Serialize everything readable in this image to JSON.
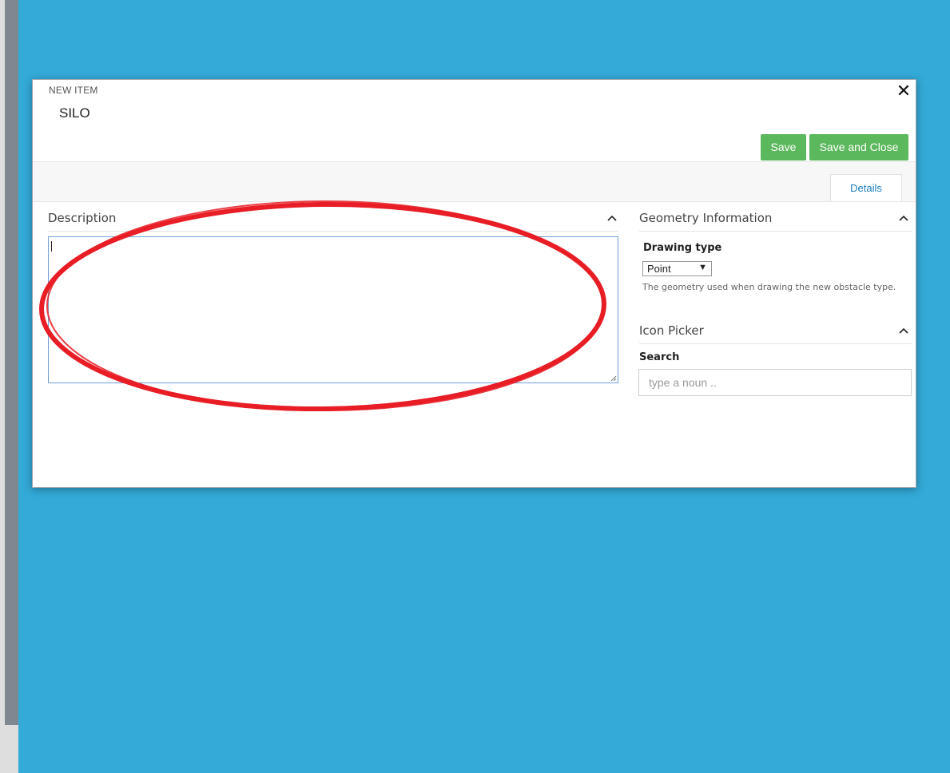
{
  "dialog": {
    "overline": "NEW ITEM",
    "title": "SILO",
    "close_glyph": "✕"
  },
  "actions": {
    "save_label": "Save",
    "save_close_label": "Save and Close"
  },
  "tabs": [
    {
      "label": "Details",
      "active": true
    }
  ],
  "description": {
    "title": "Description",
    "value": ""
  },
  "geometry": {
    "title": "Geometry Information",
    "drawing_type_label": "Drawing type",
    "drawing_type_value": "Point",
    "drawing_type_arrow": "▼",
    "help_text": "The geometry used when drawing the new obstacle type."
  },
  "icon_picker": {
    "title": "Icon Picker",
    "search_label": "Search",
    "search_placeholder": "type a noun .."
  },
  "colors": {
    "backdrop": "#33aad8",
    "button_green": "#5cb85c",
    "tab_link": "#1a7fc1",
    "annotation_red": "#e81d25"
  },
  "icons": [
    "close-icon",
    "chevron-up-icon",
    "dropdown-arrow-icon",
    "resize-grip-icon"
  ]
}
